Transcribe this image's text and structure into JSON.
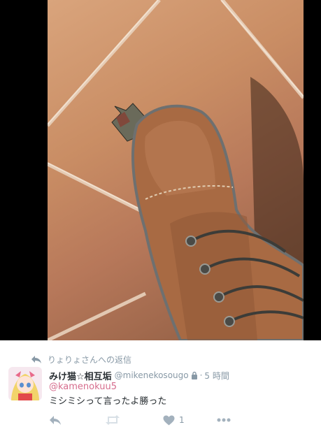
{
  "tweet": {
    "reply_context": "りょりょさんへの返信",
    "display_name": "みけ猫☆相互垢",
    "handle": "@mikenekosougo",
    "separator": "·",
    "time": "5 時間",
    "mention": "@kamenokuu5",
    "text": "ミシミシって言ったよ勝った",
    "like_count": "1"
  },
  "icons": {
    "reply_context": "reply-arrow-icon",
    "lock": "lock-icon",
    "reply": "reply-icon",
    "retweet": "retweet-icon",
    "like": "heart-icon",
    "more": "more-dots-icon"
  },
  "colors": {
    "text": "#292f33",
    "muted": "#8899a6",
    "mention": "#d66d8d",
    "action_icon": "#a3b1bd",
    "retweet_disabled": "#d8e0e6"
  }
}
